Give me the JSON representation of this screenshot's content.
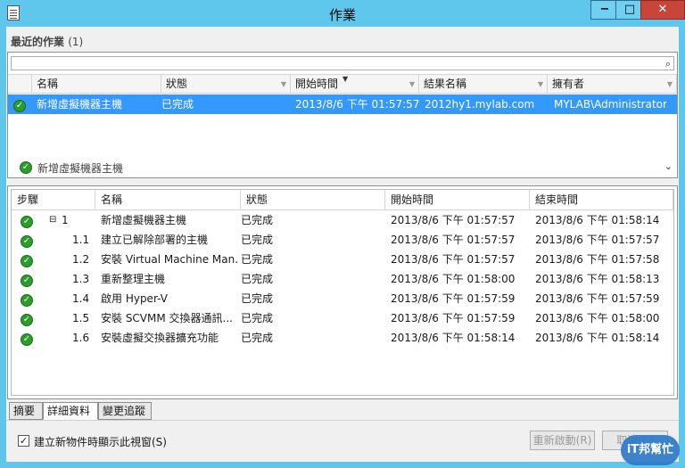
{
  "window": {
    "title": "作業"
  },
  "recent": {
    "title": "最近的作業",
    "count": "(1)"
  },
  "search": {
    "placeholder": ""
  },
  "jobs": {
    "columns": [
      "名稱",
      "狀態",
      "開始時間",
      "結果名稱",
      "擁有者"
    ],
    "rows": [
      {
        "name": "新增虛擬機器主機",
        "status": "已完成",
        "start": "2013/8/6 下午 01:57:57",
        "result": "2012hy1.mylab.com",
        "owner": "MYLAB\\Administrator"
      }
    ]
  },
  "detail": {
    "title": "新增虛擬機器主機"
  },
  "steps": {
    "columns": [
      "步驟",
      "名稱",
      "狀態",
      "開始時間",
      "結束時間"
    ],
    "rows": [
      {
        "step": "1",
        "name": "新增虛擬機器主機",
        "status": "已完成",
        "start": "2013/8/6 下午 01:57:57",
        "end": "2013/8/6 下午 01:58:14"
      },
      {
        "step": "1.1",
        "name": "建立已解除部署的主機",
        "status": "已完成",
        "start": "2013/8/6 下午 01:57:57",
        "end": "2013/8/6 下午 01:57:57"
      },
      {
        "step": "1.2",
        "name": "安裝 Virtual Machine Man...",
        "status": "已完成",
        "start": "2013/8/6 下午 01:57:57",
        "end": "2013/8/6 下午 01:57:58"
      },
      {
        "step": "1.3",
        "name": "重新整理主機",
        "status": "已完成",
        "start": "2013/8/6 下午 01:58:00",
        "end": "2013/8/6 下午 01:58:13"
      },
      {
        "step": "1.4",
        "name": "啟用 Hyper-V",
        "status": "已完成",
        "start": "2013/8/6 下午 01:57:59",
        "end": "2013/8/6 下午 01:57:59"
      },
      {
        "step": "1.5",
        "name": "安裝 SCVMM 交換器通訊...",
        "status": "已完成",
        "start": "2013/8/6 下午 01:57:59",
        "end": "2013/8/6 下午 01:58:00"
      },
      {
        "step": "1.6",
        "name": "安裝虛擬交換器擴充功能",
        "status": "已完成",
        "start": "2013/8/6 下午 01:58:14",
        "end": "2013/8/6 下午 01:58:14"
      }
    ]
  },
  "tabs": [
    "摘要",
    "詳細資料",
    "變更追蹤"
  ],
  "footer": {
    "checkbox_label": "建立新物件時顯示此視窗(S)",
    "checked": true,
    "restart_label": "重新啟動(R)",
    "cancel_label": "取消(C)"
  },
  "watermark": {
    "text": "iT邦幫忙"
  },
  "colors": {
    "titlebar": "#5fc6ec",
    "selection": "#3399ff",
    "success": "#2a9d2a",
    "close": "#c7453a"
  }
}
